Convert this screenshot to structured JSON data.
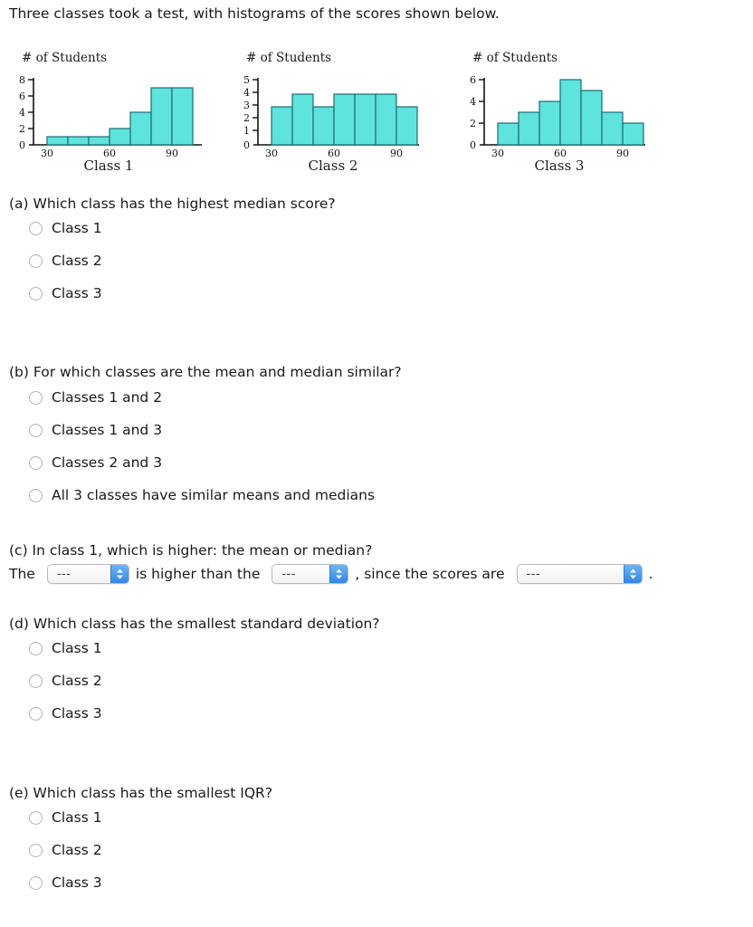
{
  "intro": "Three classes took a test, with histograms of the scores shown below.",
  "chart_data": [
    {
      "type": "bar",
      "title": "# of Students",
      "caption": "Class 1",
      "xlabel": "",
      "ylabel": "# of Students",
      "categories": [
        "30",
        "40",
        "50",
        "60",
        "70",
        "80",
        "90"
      ],
      "values": [
        1,
        1,
        1,
        2,
        4,
        7,
        7
      ],
      "xticks": [
        "30",
        "60",
        "90"
      ],
      "yticks": [
        "0",
        "2",
        "4",
        "6",
        "8"
      ],
      "ylim": [
        0,
        8
      ],
      "xlim": [
        20,
        100
      ],
      "bin_width": 10,
      "bar_color": "#5fe3dd",
      "bar_border": "#1d6b72",
      "grid": false,
      "legend": false
    },
    {
      "type": "bar",
      "title": "# of Students",
      "caption": "Class 2",
      "xlabel": "",
      "ylabel": "# of Students",
      "categories": [
        "30",
        "40",
        "50",
        "60",
        "70",
        "80",
        "90"
      ],
      "values": [
        3,
        4,
        3,
        4,
        4,
        4,
        3
      ],
      "xticks": [
        "30",
        "60",
        "90"
      ],
      "yticks": [
        "0",
        "1",
        "2",
        "3",
        "4",
        "5"
      ],
      "ylim": [
        0,
        5
      ],
      "xlim": [
        20,
        100
      ],
      "bin_width": 10,
      "bar_color": "#5fe3dd",
      "bar_border": "#1d6b72",
      "grid": false,
      "legend": false
    },
    {
      "type": "bar",
      "title": "# of Students",
      "caption": "Class 3",
      "xlabel": "",
      "ylabel": "# of Students",
      "categories": [
        "30",
        "40",
        "50",
        "60",
        "70",
        "80",
        "90"
      ],
      "values": [
        2,
        3,
        4,
        6,
        5,
        3,
        2
      ],
      "xticks": [
        "30",
        "60",
        "90"
      ],
      "yticks": [
        "0",
        "2",
        "4",
        "6"
      ],
      "ylim": [
        0,
        6
      ],
      "xlim": [
        20,
        100
      ],
      "bin_width": 10,
      "bar_color": "#5fe3dd",
      "bar_border": "#1d6b72",
      "grid": false,
      "legend": false
    }
  ],
  "questions": {
    "a": {
      "prompt": "(a) Which class has the highest median score?",
      "options": [
        "Class 1",
        "Class 2",
        "Class 3"
      ]
    },
    "b": {
      "prompt": "(b) For which classes are the mean and median similar?",
      "options": [
        "Classes 1 and 2",
        "Classes 1 and 3",
        "Classes 2 and 3",
        "All 3 classes have similar means and medians"
      ]
    },
    "c": {
      "prompt": "(c) In class 1, which is higher: the mean or median?",
      "text_1": "The",
      "select_1": "---",
      "text_2": "is higher than the",
      "select_2": "---",
      "text_3": ", since the scores are",
      "select_3": "---",
      "text_4": "."
    },
    "d": {
      "prompt": "(d) Which class has the smallest standard deviation?",
      "options": [
        "Class 1",
        "Class 2",
        "Class 3"
      ]
    },
    "e": {
      "prompt": "(e) Which class has the smallest IQR?",
      "options": [
        "Class 1",
        "Class 2",
        "Class 3"
      ]
    }
  }
}
